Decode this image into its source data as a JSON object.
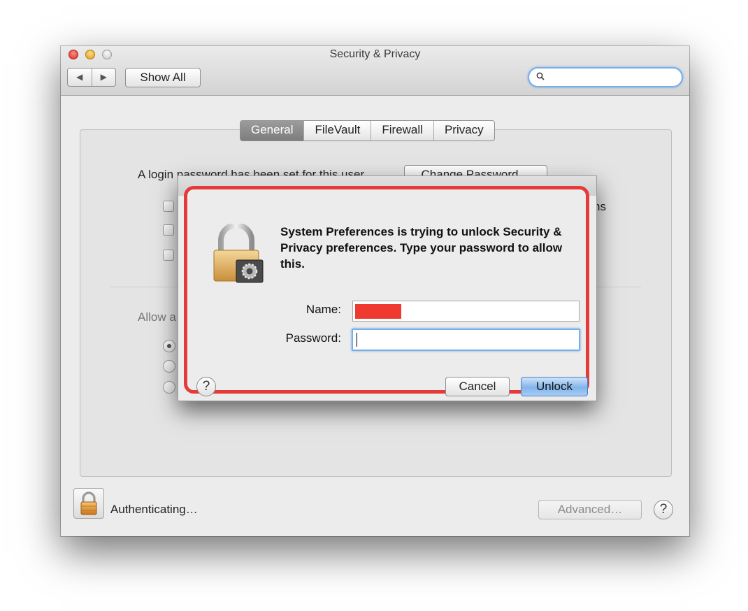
{
  "window": {
    "title": "Security & Privacy",
    "show_all_label": "Show All",
    "back_glyph": "◀",
    "forward_glyph": "▶",
    "search": {
      "placeholder": "",
      "value": ""
    }
  },
  "tabs": [
    {
      "label": "General",
      "selected": true
    },
    {
      "label": "FileVault",
      "selected": false
    },
    {
      "label": "Firewall",
      "selected": false
    },
    {
      "label": "Privacy",
      "selected": false
    }
  ],
  "general_pane": {
    "login_text": "A login password has been set for this user",
    "change_password_label": "Change Password…",
    "right_fragment": "ns",
    "allow_fragment": "Allow a"
  },
  "footer": {
    "status": "Authenticating…",
    "advanced_label": "Advanced…",
    "help_glyph": "?"
  },
  "dialog": {
    "message": "System Preferences is trying to unlock Security & Privacy preferences. Type your password to allow this.",
    "name_label": "Name:",
    "password_label": "Password:",
    "name_value": "",
    "password_value": "",
    "cancel_label": "Cancel",
    "unlock_label": "Unlock",
    "help_glyph": "?"
  },
  "colors": {
    "highlight": "#e5393a",
    "redaction": "#ee3a2f",
    "focus_ring": "#7aaee5",
    "default_button": "#82b4ea"
  },
  "icons": [
    "search-icon",
    "lock-icon",
    "gear-icon",
    "help-icon"
  ]
}
